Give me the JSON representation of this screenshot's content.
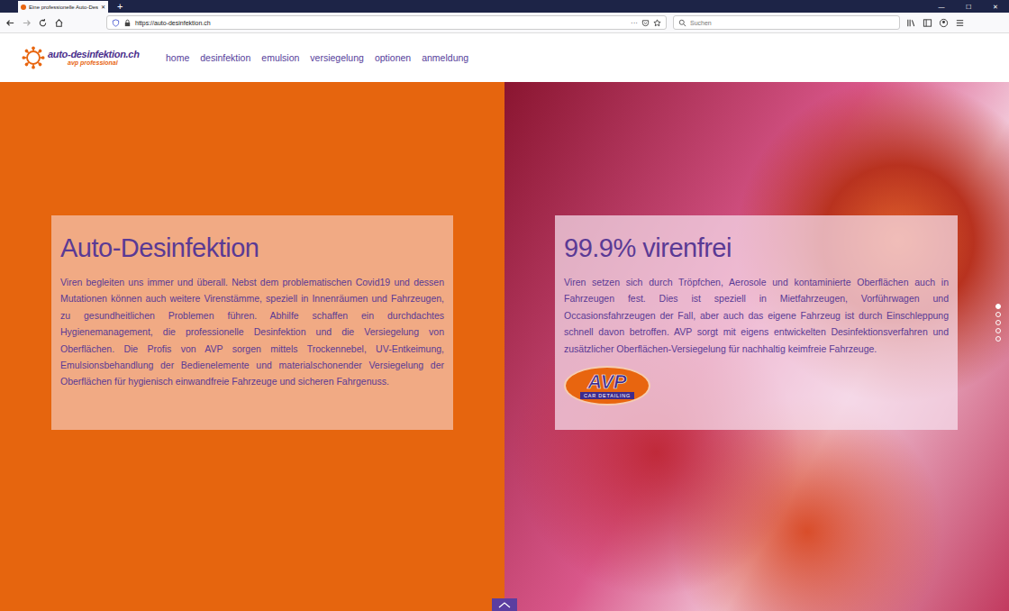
{
  "browser": {
    "tab_title": "Eine professionelle Auto-Desi",
    "new_tab": "+",
    "window_controls": [
      "—",
      "☐",
      "✕"
    ],
    "url": "https://auto-desinfektion.ch",
    "search": {
      "placeholder": "Suchen"
    },
    "page_actions": "···"
  },
  "site": {
    "logo": {
      "name": "auto-desinfektion.ch",
      "subtitle": "avp professional"
    },
    "nav": [
      {
        "label": "home"
      },
      {
        "label": "desinfektion"
      },
      {
        "label": "emulsion"
      },
      {
        "label": "versiegelung"
      },
      {
        "label": "optionen"
      },
      {
        "label": "anmeldung"
      }
    ]
  },
  "hero": {
    "left": {
      "title": "Auto-Desinfektion",
      "text": "Viren begleiten uns immer und überall. Nebst dem problematischen Covid19 und dessen Mutationen können auch weitere Virenstämme, speziell in Innenräumen und Fahrzeugen, zu gesundheitlichen Problemen führen. Abhilfe schaffen ein durchdachtes Hygienemanagement, die professionelle Desinfektion und die Versiegelung von Oberflächen. Die Profis von AVP sorgen mittels Trockennebel, UV-Entkeimung, Emulsionsbehandlung der Bedienelemente und materialschonender Versiegelung der Oberflächen für hygienisch einwandfreie Fahrzeuge und sicheren Fahrgenuss."
    },
    "right": {
      "title": "99.9% virenfrei",
      "text": "Viren setzen sich durch Tröpfchen, Aerosole und kontaminierte Oberflächen auch in Fahrzeugen fest. Dies ist speziell in Mietfahrzeugen, Vorführwagen und Occasionsfahrzeugen der Fall, aber auch das eigene Fahrzeug ist durch Einschleppung schnell davon betroffen. AVP sorgt mit eigens entwickelten Desinfektionsverfahren und zusätzlicher Oberflächen-Versiegelung für nachhaltig keimfreie Fahrzeuge.",
      "badge": {
        "brand": "AVP",
        "tagline": "CAR DETAILING"
      }
    },
    "slider_dots": [
      {
        "selected": true
      },
      {
        "selected": false
      },
      {
        "selected": false
      },
      {
        "selected": false
      },
      {
        "selected": false
      }
    ]
  }
}
